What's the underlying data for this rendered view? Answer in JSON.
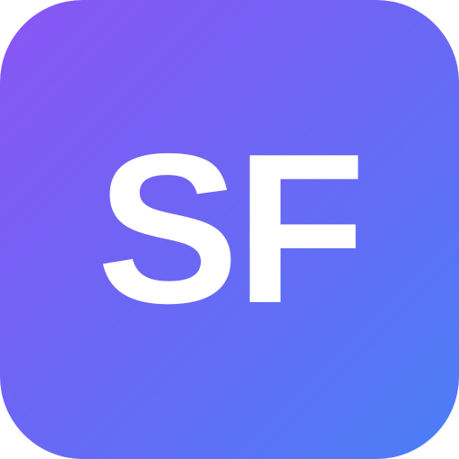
{
  "icon": {
    "monogram": "SF",
    "colors": {
      "gradient_start": "#8a55f4",
      "gradient_mid": "#6d66f5",
      "gradient_end": "#4a7ef6",
      "text": "#ffffff"
    }
  }
}
